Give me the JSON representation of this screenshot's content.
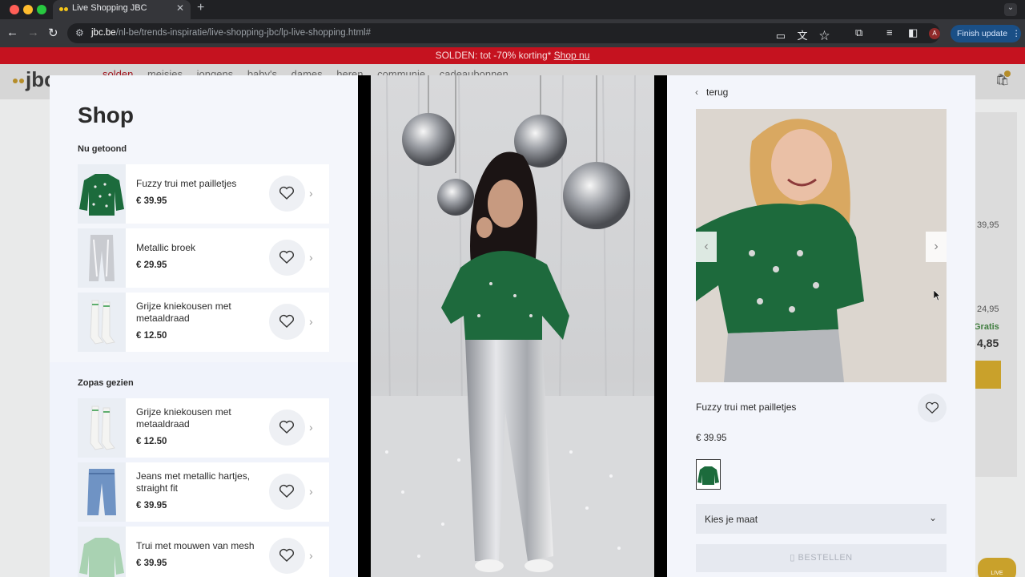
{
  "browser": {
    "tab_title": "Live Shopping JBC",
    "tab_close": "✕",
    "new_tab": "+",
    "url_host": "jbc.be",
    "url_path": "/nl-be/trends-inspiratie/live-shopping-jbc/lp-live-shopping.html#",
    "avatar_letter": "A",
    "finish_update_label": "Finish update",
    "colors": {
      "close": "#ff5f57",
      "minimize": "#febc2e",
      "maximize": "#28c840"
    }
  },
  "site": {
    "promo_text": "SOLDEN: tot -70% korting*",
    "promo_link": "Shop nu",
    "logo": "jbc",
    "nav": [
      "solden",
      "meisjes",
      "jongens",
      "baby's",
      "dames",
      "heren",
      "communie",
      "cadeaubonnen"
    ],
    "bg_prices": [
      "39,95",
      "24,95"
    ],
    "bg_gratis": "Gratis",
    "bg_total": "4,85",
    "live_badge": "LIVE"
  },
  "shop": {
    "title": "Shop",
    "now_shown_title": "Nu getoond",
    "recent_title": "Zopas gezien",
    "now_shown": [
      {
        "name": "Fuzzy trui met pailletjes",
        "price": "€ 39.95"
      },
      {
        "name": "Metallic broek",
        "price": "€ 29.95"
      },
      {
        "name": "Grijze kniekousen met metaaldraad",
        "price": "€ 12.50"
      }
    ],
    "recent": [
      {
        "name": "Grijze kniekousen met metaaldraad",
        "price": "€ 12.50"
      },
      {
        "name": "Jeans met metallic hartjes, straight fit",
        "price": "€ 39.95"
      },
      {
        "name": "Trui met mouwen van mesh",
        "price": "€ 39.95"
      }
    ]
  },
  "detail": {
    "back_label": "terug",
    "product_name": "Fuzzy trui met pailletjes",
    "price": "€ 39.95",
    "size_placeholder": "Kies je maat",
    "order_label": "BESTELLEN"
  }
}
